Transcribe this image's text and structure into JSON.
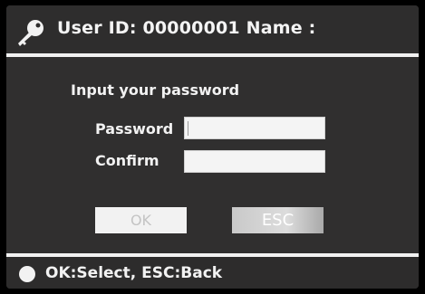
{
  "header": {
    "title": "User ID: 00000001 Name :",
    "icon": "key-icon"
  },
  "form": {
    "prompt": "Input your password",
    "password_label": "Password",
    "password_value": "",
    "confirm_label": "Confirm",
    "confirm_value": ""
  },
  "buttons": {
    "ok_label": "OK",
    "esc_label": "ESC"
  },
  "footer": {
    "icon": "dot-icon",
    "hint": "OK:Select, ESC:Back"
  },
  "colors": {
    "background": "#302f2f",
    "text": "#f2f2f2",
    "field": "#f4f4f4"
  }
}
